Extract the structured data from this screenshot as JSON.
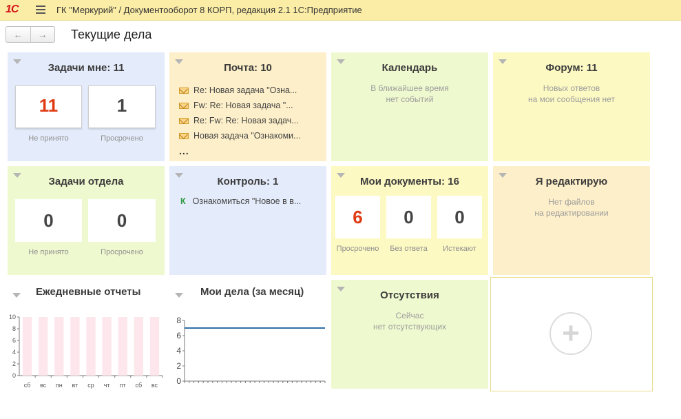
{
  "window": {
    "logo": "1С",
    "title": "ГК \"Меркурий\" / Документооборот 8 КОРП, редакция 2.1 1С:Предприятие"
  },
  "nav": {
    "back_glyph": "←",
    "forward_glyph": "→"
  },
  "page_title": "Текущие дела",
  "tasks_me": {
    "title": "Задачи мне: 11",
    "boxes": [
      {
        "value": "11",
        "label": "Не принято"
      },
      {
        "value": "1",
        "label": "Просрочено"
      }
    ]
  },
  "mail": {
    "title": "Почта: 10",
    "items": [
      "Re: Новая задача \"Озна...",
      "Fw: Re: Новая задача \"...",
      "Re: Fw: Re: Новая задач...",
      "Новая задача \"Ознакоми..."
    ],
    "more": "..."
  },
  "calendar": {
    "title": "Календарь",
    "message": "В ближайшее время\nнет событий"
  },
  "forum": {
    "title": "Форум: 11",
    "message": "Новых ответов\nна мои сообщения нет"
  },
  "dept_tasks": {
    "title": "Задачи отдела",
    "boxes": [
      {
        "value": "0",
        "label": "Не принято"
      },
      {
        "value": "0",
        "label": "Просрочено"
      }
    ]
  },
  "control": {
    "title": "Контроль: 1",
    "item_marker": "К",
    "item_text": "Ознакомиться \"Новое в в..."
  },
  "my_docs": {
    "title": "Мои документы: 16",
    "boxes": [
      {
        "value": "6",
        "label": "Просрочено"
      },
      {
        "value": "0",
        "label": "Без ответа"
      },
      {
        "value": "0",
        "label": "Истекают"
      }
    ]
  },
  "editing": {
    "title": "Я редактирую",
    "message": "Нет файлов\nна редактировании"
  },
  "absences": {
    "title": "Отсутствия",
    "message": "Сейчас\nнет отсутствующих"
  },
  "add_tile": {
    "glyph": "+"
  },
  "colors": {
    "title_bar": "#fbeda6",
    "tile_blue": "#e4ebfa",
    "tile_orange": "#fdefc9",
    "tile_green": "#eff9cf",
    "tile_yellow": "#fcf9c3",
    "accent_red": "#e03a13",
    "bar_pink": "#fde7ec",
    "line_blue": "#2f6ea6"
  },
  "chart_data": [
    {
      "type": "bar",
      "title": "Ежедневные отчеты",
      "categories": [
        "сб",
        "вс",
        "пн",
        "вт",
        "ср",
        "чт",
        "пт",
        "сб",
        "вс"
      ],
      "values": [
        10,
        10,
        10,
        10,
        10,
        10,
        10,
        10,
        10
      ],
      "ylim": [
        0,
        10
      ],
      "yticks": [
        "10",
        "8",
        "6",
        "4",
        "2",
        "0"
      ],
      "grid": false
    },
    {
      "type": "line",
      "title": "Мои дела (за месяц)",
      "x": [
        0,
        1
      ],
      "y": [
        7,
        7
      ],
      "ylim": [
        0,
        8
      ],
      "yticks": [
        "8",
        "6",
        "4",
        "2",
        "0"
      ],
      "grid": false
    }
  ]
}
